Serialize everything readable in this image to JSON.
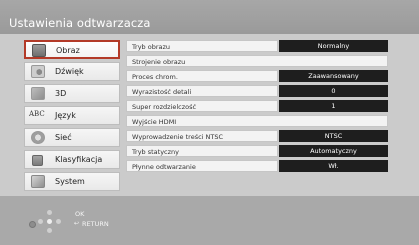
{
  "header": {
    "title": "Ustawienia odtwarzacza"
  },
  "sidebar": {
    "items": [
      {
        "label": "Obraz",
        "icon": "picture-icon",
        "active": true
      },
      {
        "label": "Dźwięk",
        "icon": "speaker-icon",
        "active": false
      },
      {
        "label": "3D",
        "icon": "3d-glasses-icon",
        "active": false
      },
      {
        "label": "Język",
        "icon": "abc-language-icon",
        "active": false
      },
      {
        "label": "Sieć",
        "icon": "network-icon",
        "active": false
      },
      {
        "label": "Klasyfikacja",
        "icon": "lock-icon",
        "active": false
      },
      {
        "label": "System",
        "icon": "system-icon",
        "active": false
      }
    ]
  },
  "settings": {
    "rows": [
      {
        "label": "Tryb obrazu",
        "value": "Normalny"
      },
      {
        "label": "Strojenie obrazu",
        "value": ""
      },
      {
        "label": "Proces chrom.",
        "value": "Zaawansowany"
      },
      {
        "label": "Wyrazistość detali",
        "value": "0"
      },
      {
        "label": "Super rozdzielczość",
        "value": "1"
      },
      {
        "label": "Wyjście HDMI",
        "value": ""
      },
      {
        "label": "Wyprowadzenie treści NTSC",
        "value": "NTSC"
      },
      {
        "label": "Tryb statyczny",
        "value": "Automatyczny"
      },
      {
        "label": "Płynne odtwarzanie",
        "value": "Wł."
      }
    ]
  },
  "footer": {
    "ok_label": "OK",
    "return_label": "RETURN"
  },
  "colors": {
    "active_border": "#b33a28",
    "value_bg": "#1e1e1e",
    "header_bg": "#a7a7a7"
  }
}
